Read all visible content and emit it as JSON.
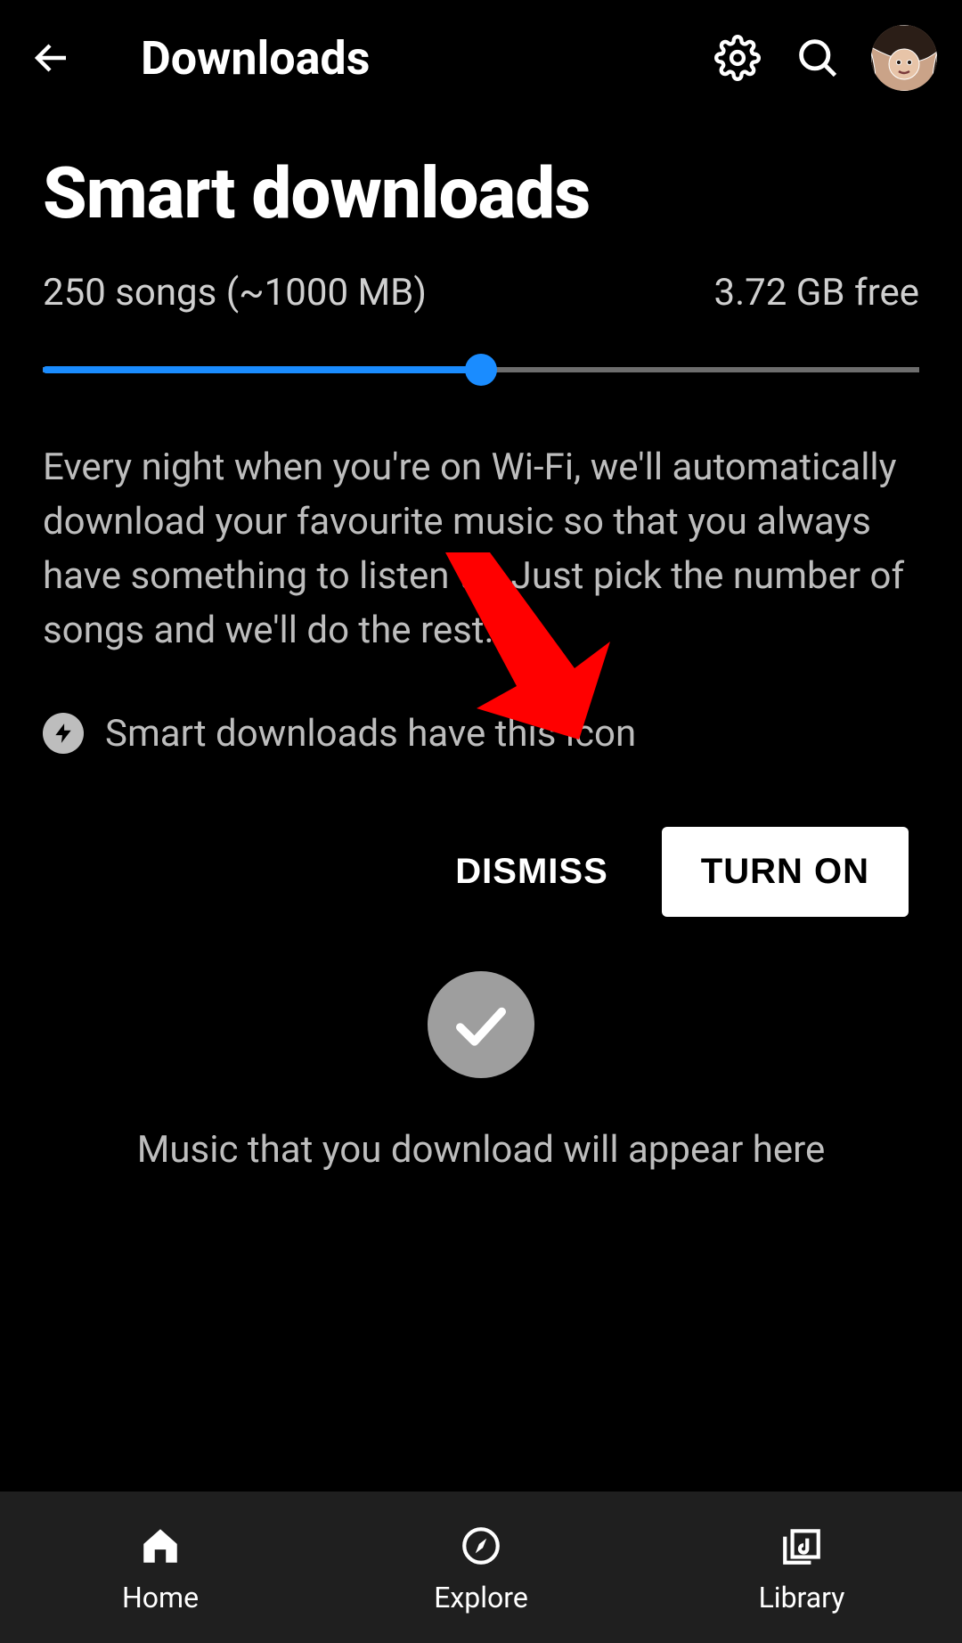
{
  "appbar": {
    "title": "Downloads"
  },
  "smart": {
    "heading": "Smart downloads",
    "songs_label": "250 songs (~1000 MB)",
    "free_label": "3.72 GB free",
    "slider_percent": 50,
    "description": "Every night when you're on Wi-Fi, we'll automatically download your favourite music so that you always have something to listen to. Just pick the number of songs and we'll do the rest.",
    "icon_hint": "Smart downloads have this icon",
    "dismiss_label": "DISMISS",
    "turn_on_label": "TURN ON"
  },
  "empty": {
    "message": "Music that you download will appear here"
  },
  "nav": {
    "home": "Home",
    "explore": "Explore",
    "library": "Library"
  },
  "colors": {
    "accent": "#1a8cff",
    "annotation": "#ff0000"
  }
}
